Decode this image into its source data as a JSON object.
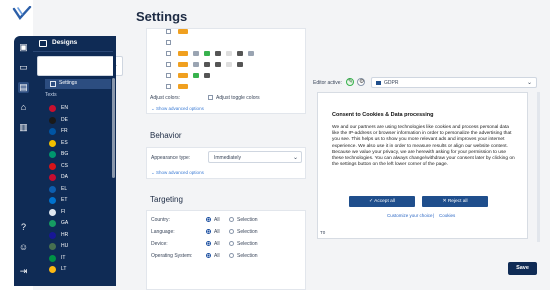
{
  "app": {
    "title": "Settings"
  },
  "colors": {
    "navy": "#0f2b55",
    "accent": "#1f4e8c",
    "toggle_on": "#f0a020",
    "toggle_green": "#37b24d"
  },
  "rail": {
    "icons": [
      "layout-icon",
      "folder-icon",
      "designs-icon",
      "bank-icon",
      "chart-icon",
      "help-icon",
      "user-icon",
      "logout-icon"
    ]
  },
  "sidebar": {
    "header": "Designs",
    "settings_label": "Settings",
    "texts_label": "Texts",
    "languages": [
      {
        "code": "EN",
        "color": "#c8102e"
      },
      {
        "code": "DE",
        "color": "#1a1a1a"
      },
      {
        "code": "FR",
        "color": "#0055a4"
      },
      {
        "code": "ES",
        "color": "#f1bf00"
      },
      {
        "code": "BG",
        "color": "#00966e"
      },
      {
        "code": "CS",
        "color": "#d7141a"
      },
      {
        "code": "DA",
        "color": "#c60c30"
      },
      {
        "code": "EL",
        "color": "#0d5eaf"
      },
      {
        "code": "ET",
        "color": "#0072ce"
      },
      {
        "code": "FI",
        "color": "#dfe7f0"
      },
      {
        "code": "GA",
        "color": "#169b62"
      },
      {
        "code": "HR",
        "color": "#171796"
      },
      {
        "code": "HU",
        "color": "#477050"
      },
      {
        "code": "IT",
        "color": "#009246"
      },
      {
        "code": "LT",
        "color": "#fdb913"
      }
    ]
  },
  "colors_section": {
    "adjust_colors": "Adjust colors:",
    "adjust_toggle_colors": "Adjust toggle colors",
    "show_advanced": "Show advanced options"
  },
  "behavior": {
    "title": "Behavior",
    "appearance_label": "Appearance type:",
    "appearance_value": "Immediately",
    "show_advanced": "Show advanced options"
  },
  "targeting": {
    "title": "Targeting",
    "rows": [
      {
        "label": "Country:",
        "all": "All",
        "selection": "Selection"
      },
      {
        "label": "Language:",
        "all": "All",
        "selection": "Selection"
      },
      {
        "label": "Device:",
        "all": "All",
        "selection": "Selection"
      },
      {
        "label": "Operating System:",
        "all": "All",
        "selection": "Selection"
      }
    ]
  },
  "editor": {
    "label": "Editor active:",
    "gdpr_value": "GDPR"
  },
  "preview": {
    "title": "Consent to Cookies & Data processing",
    "body": "We and our partners are using technologies like cookies and process personal data like the IP-address or browser information in order to personalize the advertising that you see. This helps us to show you more relevant ads and improves your internet experience. We also use it in order to measure results or align our website content. Because we value your privacy, we are herewith asking for your permission to use these technologies. You can always change/withdraw your consent later by clicking on the settings button on the left lower corner of the page.",
    "accept_label": "Accept all",
    "reject_label": "Reject all",
    "customize_link": "Customize your choice",
    "separator": "|",
    "cookies_link": "Cookies",
    "badge": "T0"
  },
  "save_label": "Save"
}
